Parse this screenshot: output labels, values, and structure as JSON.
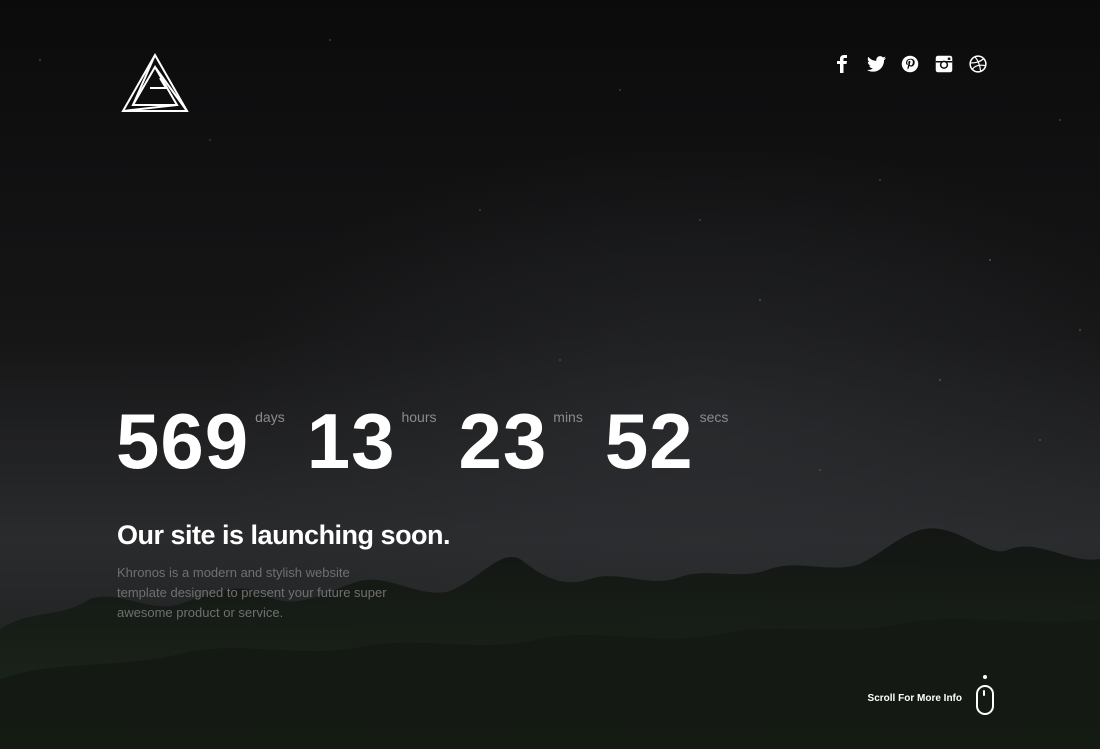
{
  "header": {
    "logo_icon": "impossible-triangle-logo",
    "social_icons": [
      "facebook-icon",
      "twitter-icon",
      "pinterest-icon",
      "instagram-icon",
      "dribbble-icon"
    ]
  },
  "countdown": {
    "days": {
      "value": "569",
      "label": "days"
    },
    "hours": {
      "value": "13",
      "label": "hours"
    },
    "mins": {
      "value": "23",
      "label": "mins"
    },
    "secs": {
      "value": "52",
      "label": "secs"
    }
  },
  "hero": {
    "headline": "Our site is launching soon.",
    "description": "Khronos is a modern and stylish website template designed to present your future super awesome product or service."
  },
  "scroll": {
    "label": "Scroll For More Info",
    "icon": "mouse-scroll-icon"
  },
  "colors": {
    "text": "#ffffff",
    "muted": "#8b8b8c",
    "background": "#0c0c0d"
  }
}
